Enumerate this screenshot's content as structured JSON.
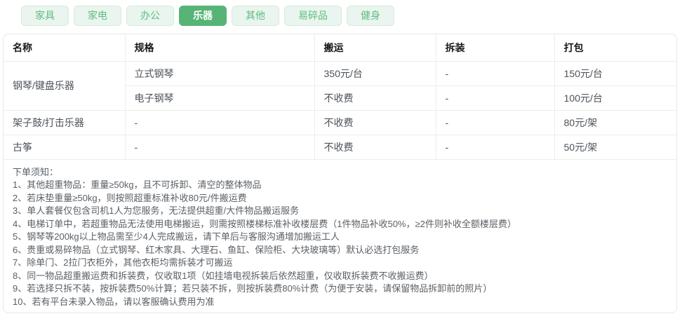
{
  "tabs": {
    "items": [
      {
        "label": "家具",
        "active": false
      },
      {
        "label": "家电",
        "active": false
      },
      {
        "label": "办公",
        "active": false
      },
      {
        "label": "乐器",
        "active": true
      },
      {
        "label": "其他",
        "active": false
      },
      {
        "label": "易碎品",
        "active": false
      },
      {
        "label": "健身",
        "active": false
      }
    ]
  },
  "table": {
    "headers": [
      "名称",
      "规格",
      "搬运",
      "拆装",
      "打包"
    ],
    "rows": [
      {
        "name": "钢琴/键盘乐器",
        "spec": "立式钢琴",
        "move": "350元/台",
        "disassemble": "-",
        "pack": "150元/台"
      },
      {
        "name": "钢琴/键盘乐器",
        "spec": "电子钢琴",
        "move": "不收费",
        "disassemble": "-",
        "pack": "100元/台"
      },
      {
        "name": "架子鼓/打击乐器",
        "spec": "-",
        "move": "不收费",
        "disassemble": "-",
        "pack": "80元/架"
      },
      {
        "name": "古筝",
        "spec": "-",
        "move": "不收费",
        "disassemble": "-",
        "pack": "50元/架"
      }
    ]
  },
  "notes": {
    "title": "下单须知：",
    "items": [
      "1、其他超重物品：重量≥50kg，且不可拆卸、清空的整体物品",
      "2、若床垫重量≥50kg，则按照超重标准补收80元/件搬运费",
      "3、单人套餐仅包含司机1人为您服务，无法提供超重/大件物品搬运服务",
      "4、电梯订单中，若超重物品无法使用电梯搬运，则需按照楼梯标准补收楼层费（1件物品补收50%，≥2件则补收全额楼层费）",
      "5、钢琴等200kg以上物品需至少4人完成搬运，请下单后与客服沟通增加搬运工人",
      "6、贵重或易碎物品（立式钢琴、红木家具、大理石、鱼缸、保险柜、大块玻璃等）默认必选打包服务",
      "7、除单门、2拉门衣柜外，其他衣柜均需拆装才可搬运",
      "8、同一物品超重搬运费和拆装费，仅收取1项（如挂墙电视拆装后依然超重，仅收取拆装费不收搬运费）",
      "9、若选择只拆不装，按拆装费50%计算；若只装不拆，则按拆装费80%计费（为便于安装，请保留物品拆卸前的照片）",
      "10、若有平台未录入物品，请以客服确认费用为准"
    ]
  },
  "colors": {
    "accent_green": "#57b476",
    "tab_inactive_bg": "#e9f5ee",
    "tab_inactive_text": "#61bc80",
    "tab_inactive_border": "#d5ecdd",
    "table_border": "#e6efe9",
    "header_text": "#17191d",
    "cell_text": "#4c525a",
    "note_text": "#5a6066"
  }
}
